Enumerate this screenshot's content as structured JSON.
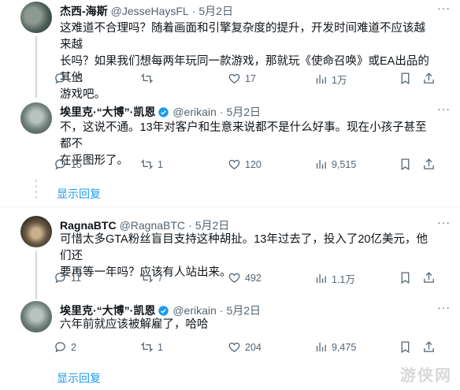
{
  "tweets": [
    {
      "name": "杰西-海斯",
      "handle": "@JesseHaysFL",
      "date": "5月2日",
      "verified": false,
      "lines": [
        "这难道不合理吗？随着画面和引擎复杂度的提升，开发时间难道不应该越来越",
        "长吗？如果我们想每两年玩同一款游戏，那就玩《使命召唤》或EA出品的其他",
        "游戏吧。"
      ],
      "replies": "15",
      "retweets": "",
      "likes": "17",
      "views": "1万"
    },
    {
      "name": "埃里克·“大博”·凯恩",
      "handle": "@erikain",
      "date": "5月2日",
      "verified": true,
      "lines": [
        "不，这说不通。13年对客户和生意来说都不是什么好事。现在小孩子甚至都不",
        "在乎图形了。"
      ],
      "replies": "15",
      "retweets": "1",
      "likes": "120",
      "views": "9,515"
    },
    {
      "name": "RagnaBTC",
      "handle": "@RagnaBTC",
      "date": "5月2日",
      "verified": false,
      "lines": [
        "可惜太多GTA粉丝盲目支持这种胡扯。13年过去了，投入了20亿美元，他们还",
        "要再等一年吗？应该有人站出来。"
      ],
      "replies": "11",
      "retweets": "7",
      "likes": "492",
      "views": "1.1万"
    },
    {
      "name": "埃里克·“大博”·凯恩",
      "handle": "@erikain",
      "date": "5月2日",
      "verified": true,
      "lines": [
        "六年前就应该被解雇了，哈哈"
      ],
      "replies": "2",
      "retweets": "1",
      "likes": "204",
      "views": "9,475"
    }
  ],
  "show_replies_label": "显示回复",
  "more_label": "···",
  "watermark": "游侠网",
  "colors": {
    "accent": "#1d9bf0",
    "secondary_text": "#536471",
    "thread_line": "#cfd9de"
  }
}
